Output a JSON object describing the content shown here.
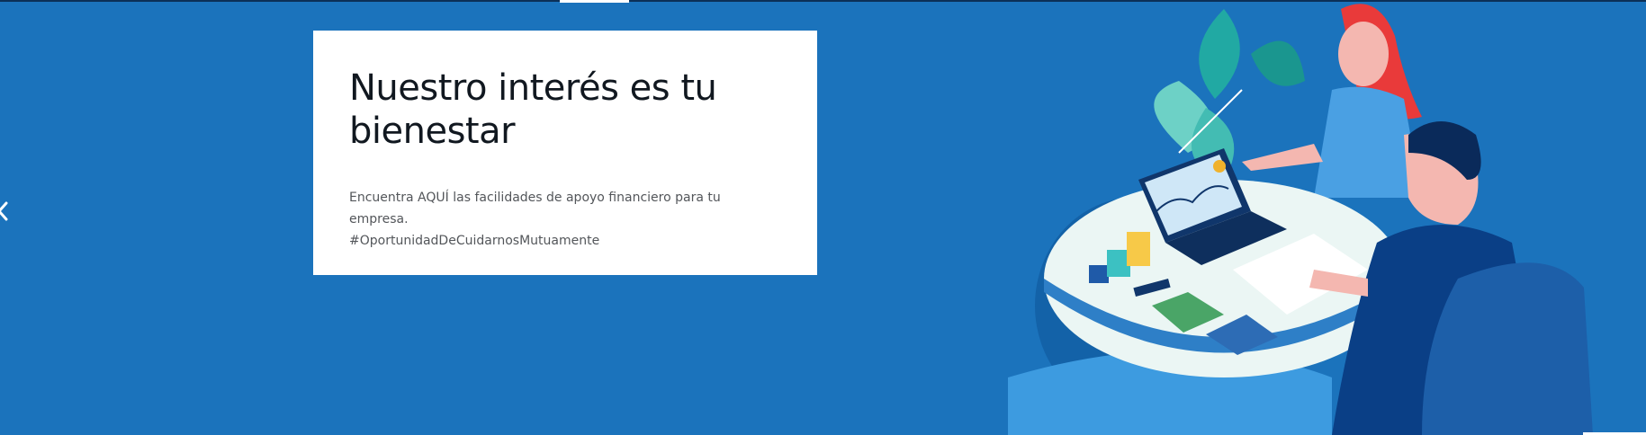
{
  "hero": {
    "title": "Nuestro interés es tu bienestar",
    "description_line1": "Encuentra AQUÍ las facilidades de apoyo financiero para tu empresa.",
    "description_line2": "#OportunidadDeCuidarnosMutuamente",
    "illustration": "business-meeting-illustration",
    "prev_icon": "chevron-left-icon"
  },
  "colors": {
    "background": "#1b73bc",
    "card": "#ffffff",
    "title": "#111820",
    "text": "#53565a"
  }
}
